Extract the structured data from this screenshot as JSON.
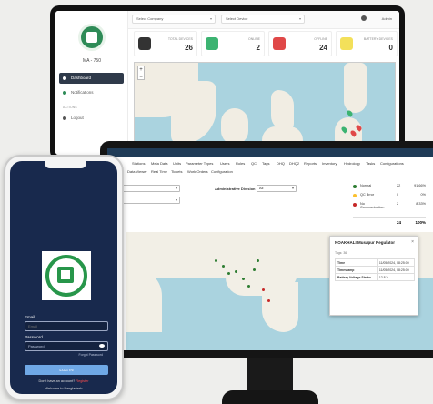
{
  "laptop": {
    "brand": "MA - 750",
    "nav": [
      {
        "label": "Dashboard",
        "active": true
      },
      {
        "label": "Notifications",
        "active": false
      }
    ],
    "section_label": "ACTIONS",
    "logout_label": "Logout",
    "select_company": "Select Company",
    "select_device": "Select Device",
    "user_label": "Admin",
    "cards": [
      {
        "label": "TOTAL DEVICES",
        "value": "26",
        "color": "#333333"
      },
      {
        "label": "ONLINE",
        "value": "2",
        "color": "#3cb371"
      },
      {
        "label": "OFFLINE",
        "value": "24",
        "color": "#e04848"
      },
      {
        "label": "BATTERY DEVICES",
        "value": "0",
        "color": "#f3e05a"
      }
    ]
  },
  "monitor": {
    "tabs": [
      "Stations",
      "Meta Data",
      "Units",
      "Parameter Types",
      "Users",
      "Roles",
      "QC",
      "Tags",
      "DHQ",
      "DHQ2",
      "Reports",
      "Inventory",
      "Hydrology",
      "Tasks",
      "Configurations"
    ],
    "subtabs": [
      "Data Viewer",
      "Real Time",
      "Tickets",
      "Work Orders",
      "Configuration"
    ],
    "admin_division_label": "Administrative Division",
    "admin_division_value": "All",
    "legend": [
      {
        "name": "Normal",
        "count": "22",
        "pct": "91.66%",
        "color": "#2e7d32"
      },
      {
        "name": "QC Error",
        "count": "0",
        "pct": "0%",
        "color": "#fbc02d"
      },
      {
        "name": "No Communication",
        "count": "2",
        "pct": "8.33%",
        "color": "#c62828"
      }
    ],
    "total_count": "24",
    "total_pct": "100%",
    "popup": {
      "title": "NOAKHALI Musapur Regulator",
      "subtitle": "Tags: 36",
      "rows": [
        {
          "key": "Time",
          "value": "11/05/2024, 08:25:00"
        },
        {
          "key": "Timestamp",
          "value": "11/05/2024, 08:25:00"
        },
        {
          "key": "Battery Voltage Status",
          "value": "12.8 V"
        }
      ]
    }
  },
  "phone": {
    "email_label": "Email",
    "email_placeholder": "Email",
    "password_label": "Password",
    "password_placeholder": "Password",
    "forgot_label": "Forgot Password",
    "login_button": "LOG IN",
    "footer_text": "Don't have an account?",
    "footer_link": "Register",
    "footer_text2": "Welcome to Bangladesh"
  }
}
